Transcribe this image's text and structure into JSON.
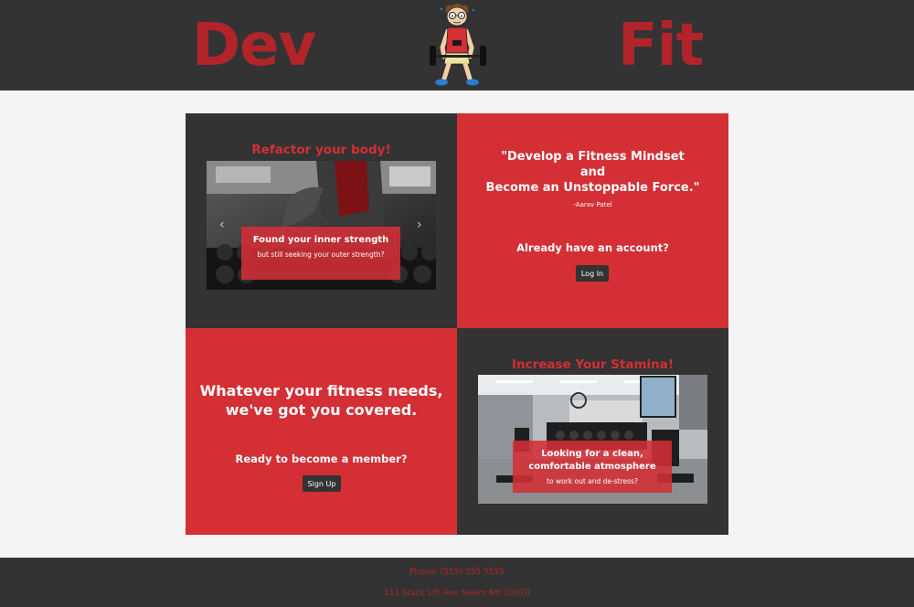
{
  "brand": {
    "left_word": "Dev",
    "right_word": "Fit",
    "mascot_icon": "weightlifter-mascot-icon"
  },
  "colors": {
    "accent": "#d32f35",
    "dark": "#333333",
    "brand_text": "#b0242a",
    "background": "#f4f4f4"
  },
  "card_refactor": {
    "title": "Refactor your body!",
    "caption_heading": "Found your inner strength",
    "caption_sub": "but still seeking your outer strength?"
  },
  "card_quote": {
    "line1": "\"Develop a Fitness Mindset",
    "line2": "and",
    "line3": "Become an Unstoppable Force.\"",
    "author": "-Aarav Patel",
    "prompt": "Already have an account?",
    "login_label": "Log In"
  },
  "card_member": {
    "line1": "Whatever your fitness needs,",
    "line2": "we've got you covered.",
    "prompt": "Ready to become a member?",
    "signup_label": "Sign Up"
  },
  "card_stamina": {
    "title": "Increase Your Stamina!",
    "caption_heading": "Looking for a clean, comfortable atmosphere",
    "caption_sub": "to work out and de-stress?"
  },
  "footer": {
    "phone": "Phone: (555) 555 5555",
    "address": "111 Stack Lift Ave Salem NH 03070"
  }
}
